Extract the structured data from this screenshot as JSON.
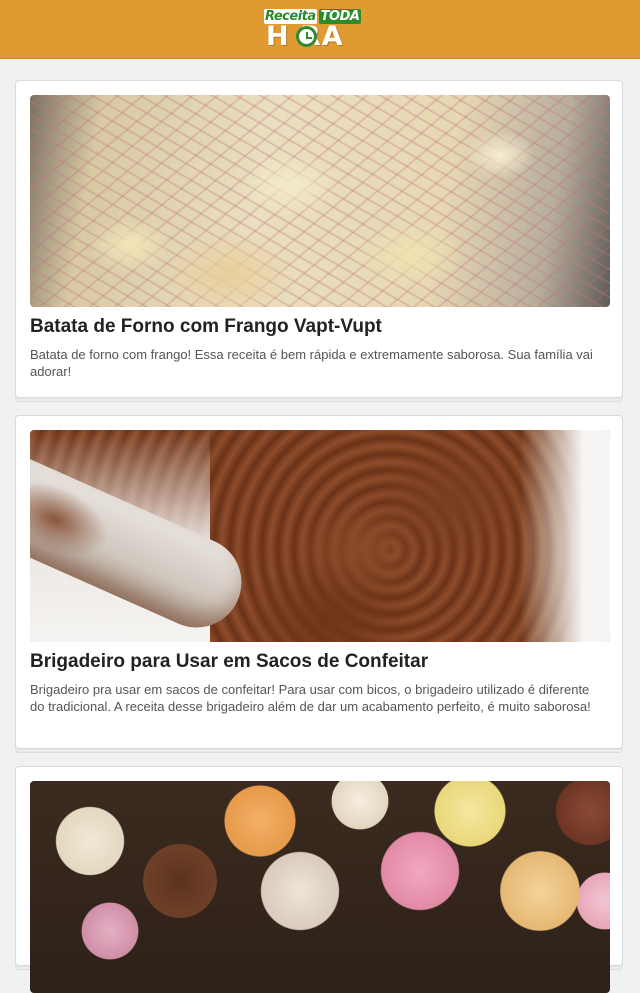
{
  "header": {
    "logo_top_word1": "Receita",
    "logo_top_word2": "TODA",
    "logo_bottom": "H  RA",
    "brand_color": "#e09a32",
    "logo_green": "#2f8a2c"
  },
  "recipes": [
    {
      "title": "Batata de Forno com Frango Vapt-Vupt",
      "description": "Batata de forno com frango! Essa receita é bem rápida e extremamente saborosa. Sua família vai adorar!"
    },
    {
      "title": "Brigadeiro para Usar em Sacos de Confeitar",
      "description": "Brigadeiro pra usar em sacos de confeitar! Para usar com bicos, o brigadeiro utilizado é diferente do tradicional. A receita desse brigadeiro além de dar um acabamento perfeito, é muito saborosa!"
    },
    {
      "title": "",
      "description": ""
    }
  ]
}
